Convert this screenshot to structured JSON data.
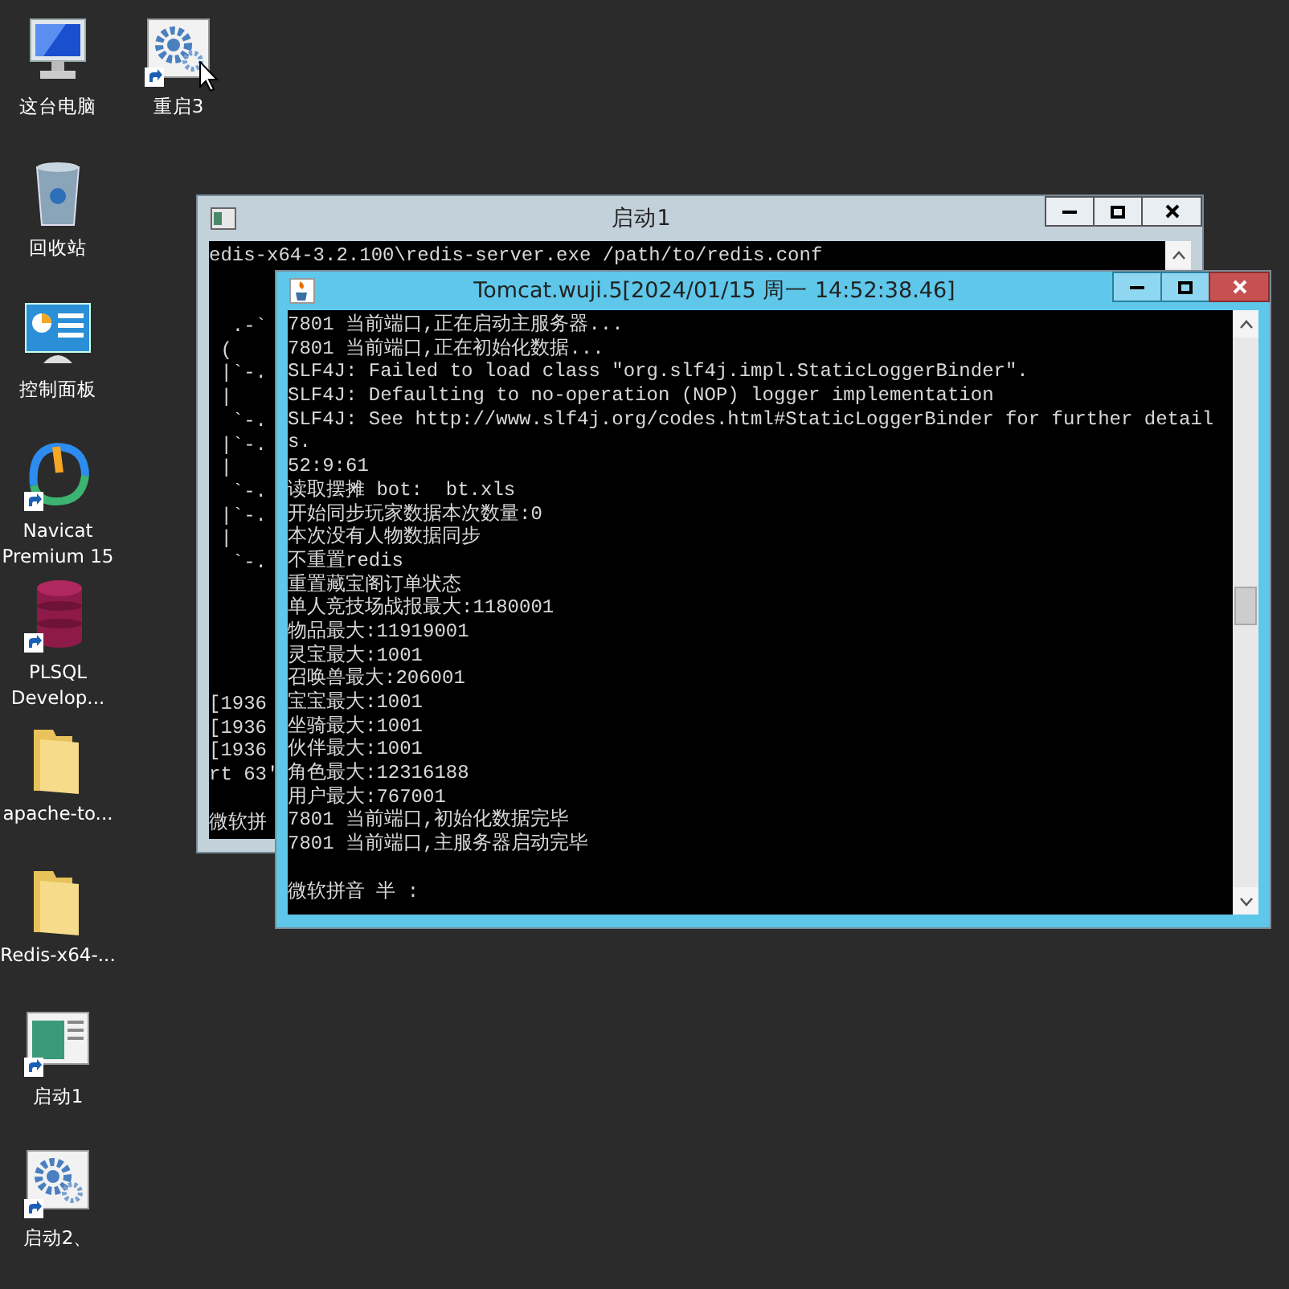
{
  "desktop_icons": [
    {
      "label": "这台电脑",
      "kind": "computer",
      "shortcut": false
    },
    {
      "label": "回收站",
      "kind": "recycle-bin",
      "shortcut": false
    },
    {
      "label": "控制面板",
      "kind": "control-panel",
      "shortcut": false
    },
    {
      "label": "Navicat Premium 15",
      "kind": "navicat",
      "shortcut": true
    },
    {
      "label": "PLSQL Develop...",
      "kind": "database",
      "shortcut": true
    },
    {
      "label": "apache-to...",
      "kind": "folder",
      "shortcut": false
    },
    {
      "label": "Redis-x64-...",
      "kind": "folder",
      "shortcut": false
    },
    {
      "label": "启动1",
      "kind": "window",
      "shortcut": true
    },
    {
      "label": "启动2、",
      "kind": "gears",
      "shortcut": true
    },
    {
      "label": "重启3",
      "kind": "gears",
      "shortcut": true
    }
  ],
  "windows": [
    {
      "title": "启动1",
      "active": false,
      "kind": "console",
      "lines": [
        {
          "kind": "text",
          "text": "edis-x64-3.2.100\\redis-server.exe /path/to/redis.conf"
        },
        {
          "kind": "blank"
        },
        {
          "kind": "blank"
        },
        {
          "kind": "text",
          "text": "  .-`"
        },
        {
          "kind": "text",
          "text": " ("
        },
        {
          "kind": "text",
          "text": " |`-."
        },
        {
          "kind": "text",
          "text": " |"
        },
        {
          "kind": "text",
          "text": "  `-."
        },
        {
          "kind": "text",
          "text": " |`-."
        },
        {
          "kind": "text",
          "text": " |"
        },
        {
          "kind": "text",
          "text": "  `-."
        },
        {
          "kind": "text",
          "text": " |`-."
        },
        {
          "kind": "text",
          "text": " |"
        },
        {
          "kind": "text",
          "text": "  `-."
        },
        {
          "kind": "blank"
        },
        {
          "kind": "blank"
        },
        {
          "kind": "blank"
        },
        {
          "kind": "blank"
        },
        {
          "kind": "blank"
        },
        {
          "kind": "text",
          "text": "[1936"
        },
        {
          "kind": "text",
          "text": "[1936"
        },
        {
          "kind": "text",
          "text": "[1936"
        },
        {
          "kind": "text",
          "text": "rt 63'"
        },
        {
          "kind": "blank"
        },
        {
          "kind": "text",
          "text": "微软拼"
        }
      ]
    },
    {
      "title": "Tomcat.wuji.5[2024/01/15 周一 14:52:38.46]",
      "active": true,
      "kind": "java",
      "lines": [
        {
          "kind": "text",
          "text": "7801 当前端口,正在启动主服务器..."
        },
        {
          "kind": "text",
          "text": "7801 当前端口,正在初始化数据..."
        },
        {
          "kind": "text",
          "text": "SLF4J: Failed to load class \"org.slf4j.impl.StaticLoggerBinder\"."
        },
        {
          "kind": "text",
          "text": "SLF4J: Defaulting to no-operation (NOP) logger implementation"
        },
        {
          "kind": "text",
          "text": "SLF4J: See http://www.slf4j.org/codes.html#StaticLoggerBinder for further detail"
        },
        {
          "kind": "text",
          "text": "s."
        },
        {
          "kind": "text",
          "text": "52:9:61"
        },
        {
          "kind": "text",
          "text": "读取摆摊 bot:  bt.xls"
        },
        {
          "kind": "text",
          "text": "开始同步玩家数据本次数量:0"
        },
        {
          "kind": "text",
          "text": "本次没有人物数据同步"
        },
        {
          "kind": "text",
          "text": "不重置redis"
        },
        {
          "kind": "text",
          "text": "重置藏宝阁订单状态"
        },
        {
          "kind": "text",
          "text": "单人竞技场战报最大:1180001"
        },
        {
          "kind": "text",
          "text": "物品最大:11919001"
        },
        {
          "kind": "text",
          "text": "灵宝最大:1001"
        },
        {
          "kind": "text",
          "text": "召唤兽最大:206001"
        },
        {
          "kind": "text",
          "text": "宝宝最大:1001"
        },
        {
          "kind": "text",
          "text": "坐骑最大:1001"
        },
        {
          "kind": "text",
          "text": "伙伴最大:1001"
        },
        {
          "kind": "text",
          "text": "角色最大:12316188"
        },
        {
          "kind": "text",
          "text": "用户最大:767001"
        },
        {
          "kind": "text",
          "text": "7801 当前端口,初始化数据完毕"
        },
        {
          "kind": "text",
          "text": "7801 当前端口,主服务器启动完毕"
        },
        {
          "kind": "blank"
        },
        {
          "kind": "text",
          "text": "微软拼音 半 :"
        }
      ]
    }
  ]
}
